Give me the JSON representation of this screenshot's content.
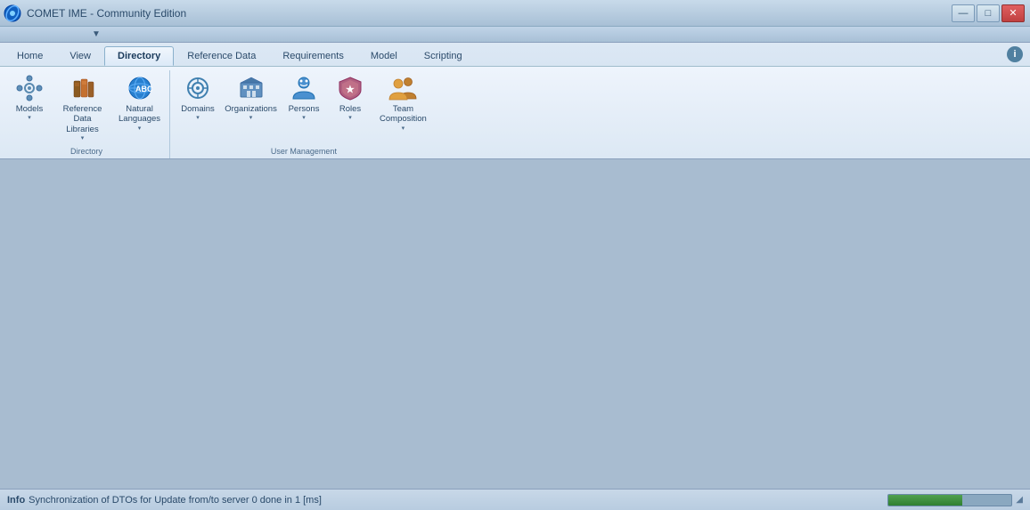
{
  "window": {
    "title": "COMET IME - Community Edition",
    "min_label": "—",
    "max_label": "□",
    "close_label": "✕"
  },
  "quick_access": {
    "item": "▼"
  },
  "menu": {
    "tabs": [
      {
        "id": "home",
        "label": "Home",
        "active": false
      },
      {
        "id": "view",
        "label": "View",
        "active": false
      },
      {
        "id": "directory",
        "label": "Directory",
        "active": true
      },
      {
        "id": "reference_data",
        "label": "Reference Data",
        "active": false
      },
      {
        "id": "requirements",
        "label": "Requirements",
        "active": false
      },
      {
        "id": "model",
        "label": "Model",
        "active": false
      },
      {
        "id": "scripting",
        "label": "Scripting",
        "active": false
      }
    ]
  },
  "ribbon": {
    "groups": [
      {
        "id": "directory_group",
        "label": "Directory",
        "items": [
          {
            "id": "models",
            "label": "Models",
            "has_arrow": true,
            "icon": "gear"
          },
          {
            "id": "reference_data_libraries",
            "label": "Reference Data\nLibraries",
            "has_arrow": true,
            "icon": "book"
          },
          {
            "id": "natural_languages",
            "label": "Natural\nLanguages",
            "has_arrow": true,
            "icon": "globe"
          }
        ]
      },
      {
        "id": "user_mgmt_group",
        "label": "User Management",
        "items": [
          {
            "id": "domains",
            "label": "Domains",
            "has_arrow": true,
            "icon": "target"
          },
          {
            "id": "organizations",
            "label": "Organizations",
            "has_arrow": true,
            "icon": "building"
          },
          {
            "id": "persons",
            "label": "Persons",
            "has_arrow": true,
            "icon": "person"
          },
          {
            "id": "roles",
            "label": "Roles",
            "has_arrow": true,
            "icon": "shield"
          },
          {
            "id": "team_composition",
            "label": "Team\nComposition",
            "has_arrow": true,
            "icon": "team"
          }
        ]
      }
    ]
  },
  "status": {
    "prefix": "Info",
    "message": "  Synchronization of DTOs for Update from/to server 0 done in 1 [ms]"
  },
  "info_icon": "i"
}
